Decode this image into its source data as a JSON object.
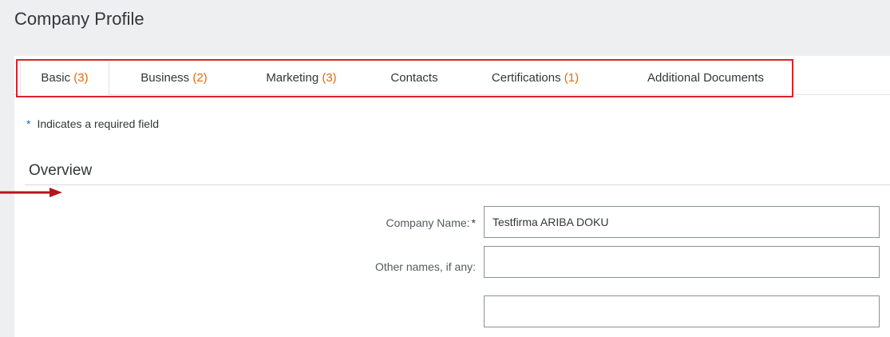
{
  "page": {
    "title": "Company Profile"
  },
  "tabs": [
    {
      "label": "Basic",
      "count": "(3)"
    },
    {
      "label": "Business",
      "count": "(2)"
    },
    {
      "label": "Marketing",
      "count": "(3)"
    },
    {
      "label": "Contacts",
      "count": ""
    },
    {
      "label": "Certifications",
      "count": "(1)"
    },
    {
      "label": "Additional Documents",
      "count": ""
    }
  ],
  "form": {
    "required_note": "Indicates a required field",
    "required_marker": "*",
    "section_title": "Overview",
    "company_name": {
      "label": "Company Name:",
      "value": "Testfirma ARIBA DOKU",
      "required_marker": "*"
    },
    "other_names": {
      "label": "Other names, if any:",
      "value": ""
    },
    "other_names_2": {
      "value": ""
    }
  },
  "colors": {
    "accent_count": "#e26b0a",
    "highlight_border": "#d9232d",
    "arrow": "#b0161c",
    "required_star": "#0a6ed1"
  }
}
